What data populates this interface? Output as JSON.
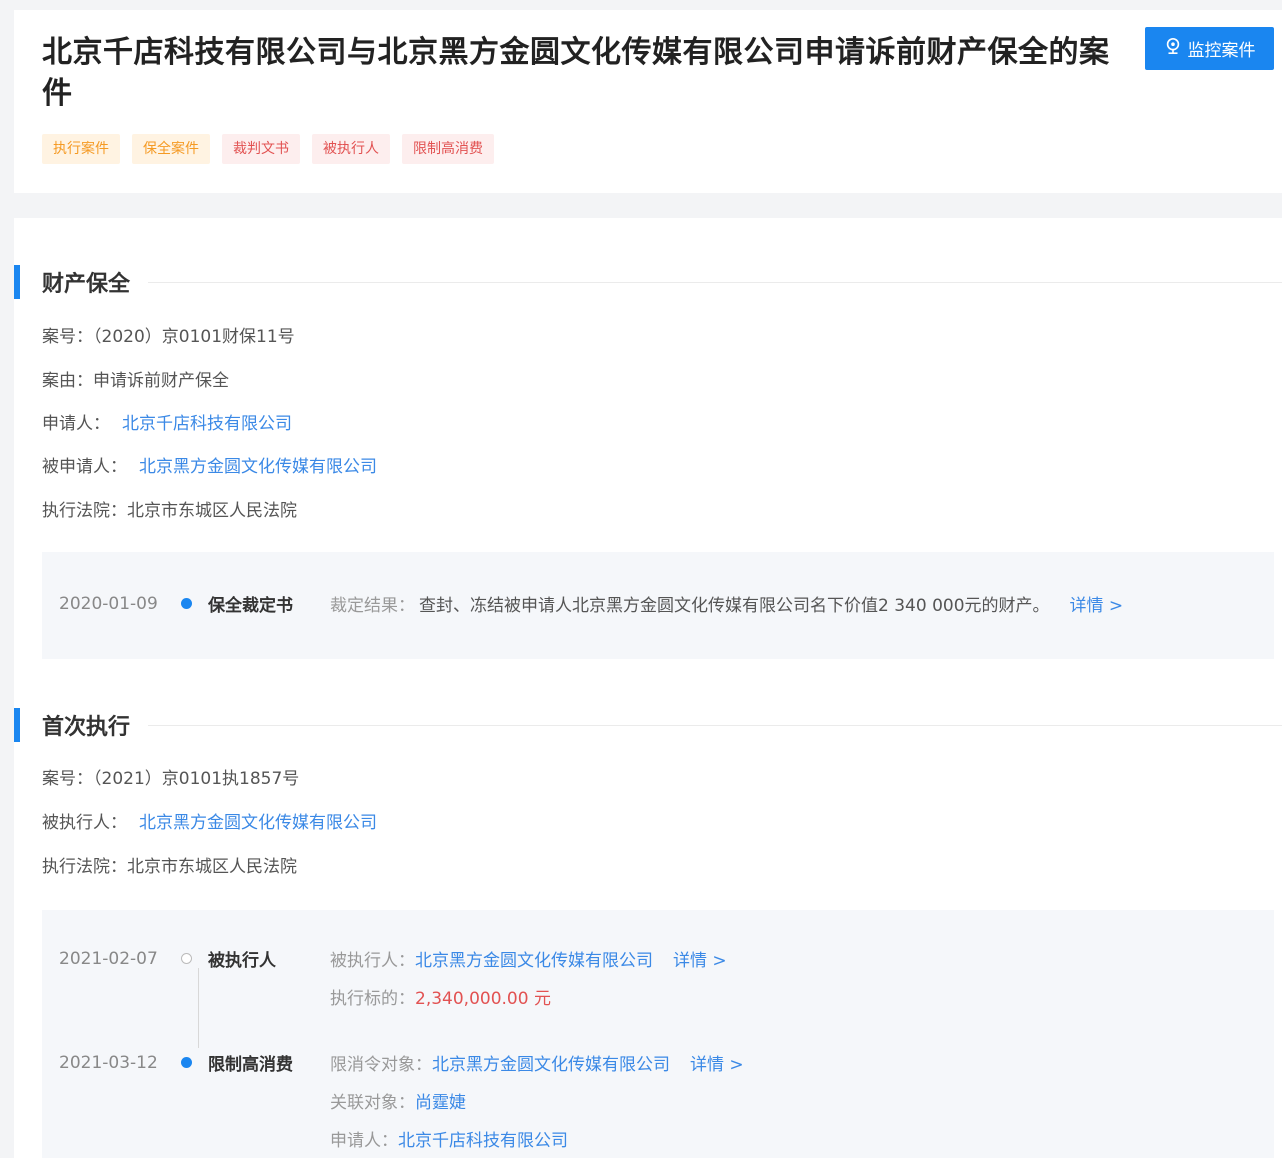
{
  "header": {
    "title": "北京千店科技有限公司与北京黑方金圆文化传媒有限公司申请诉前财产保全的案件",
    "monitor_button": "监控案件",
    "tags": [
      {
        "label": "执行案件",
        "color": "orange"
      },
      {
        "label": "保全案件",
        "color": "orange"
      },
      {
        "label": "裁判文书",
        "color": "red"
      },
      {
        "label": "被执行人",
        "color": "red"
      },
      {
        "label": "限制高消费",
        "color": "red"
      }
    ]
  },
  "preservation": {
    "title": "财产保全",
    "case_no_label": "案号：",
    "case_no": "（2020）京0101财保11号",
    "cause_label": "案由：",
    "cause": "申请诉前财产保全",
    "applicant_label": "申请人：",
    "applicant": "北京千店科技有限公司",
    "respondent_label": "被申请人：",
    "respondent": "北京黑方金圆文化传媒有限公司",
    "court_label": "执行法院：",
    "court": "北京市东城区人民法院",
    "timeline": {
      "date": "2020-01-09",
      "event": "保全裁定书",
      "result_label": "裁定结果：",
      "result": "查封、冻结被申请人北京黑方金圆文化传媒有限公司名下价值2 340 000元的财产。",
      "detail": "详情 >"
    }
  },
  "execution": {
    "title": "首次执行",
    "case_no_label": "案号：",
    "case_no": "（2021）京0101执1857号",
    "executed_label": "被执行人：",
    "executed": "北京黑方金圆文化传媒有限公司",
    "court_label": "执行法院：",
    "court": "北京市东城区人民法院",
    "timeline": [
      {
        "date": "2021-02-07",
        "event": "被执行人",
        "line1_label": "被执行人：",
        "line1_value": "北京黑方金圆文化传媒有限公司",
        "line2_label": "执行标的：",
        "line2_value": "2,340,000.00 元",
        "detail": "详情 >"
      },
      {
        "date": "2021-03-12",
        "event": "限制高消费",
        "line1_label": "限消令对象：",
        "line1_value": "北京黑方金圆文化传媒有限公司",
        "line2_label": "关联对象：",
        "line2_value": "尚霆婕",
        "line3_label": "申请人：",
        "line3_value": "北京千店科技有限公司",
        "detail": "详情 >"
      }
    ]
  },
  "colors": {
    "accent": "#1a86f0",
    "link": "#3b89e6",
    "tag_orange": "#f59a23",
    "tag_red": "#e25252"
  }
}
